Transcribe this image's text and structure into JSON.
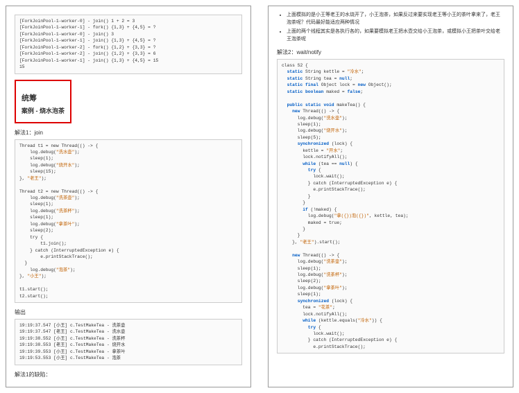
{
  "left": {
    "forkjoin_log": "[ForkJoinPool-1-worker-0] - join() 1 + 2 = 3\n[ForkJoinPool-1-worker-1] - fork() {1,3} + {4,5} = ?\n[ForkJoinPool-1-worker-0] - join() 3\n[ForkJoinPool-1-worker-1] - join() {1,3} + {4,5} = ?\n[ForkJoinPool-1-worker-2] - fork() {1,2} + {3,3} = ?\n[ForkJoinPool-1-worker-2] - join() {1,2} + {3,3} = 6\n[ForkJoinPool-1-worker-1] - join() {1,3} + {4,5} = 15\n15",
    "chapter": "统筹",
    "case_title": "案例 - 烧水泡茶",
    "sol1_title": "解法1：join",
    "sol1_code": [
      "Thread t1 = new Thread(() -> {",
      "  log.debug(",
      "  sleep(1);",
      "  log.debug(",
      "  sleep(15);",
      "}, ",
      "",
      "Thread t2 = new Thread(() -> {",
      "  log.debug(",
      "  sleep(1);",
      "  log.debug(",
      "  sleep(1);",
      "  log.debug(",
      "  sleep(2);",
      "  try {",
      "    t1.join();",
      "  } catch (InterruptedException e) {",
      "    e.printStackTrace();",
      "  }",
      "  log.debug(",
      "}, ",
      "",
      "t1.start();",
      "t2.start();"
    ],
    "sol1_strings": {
      "s1": "\"洗水壶\"",
      "s2": "\"烧开水\"",
      "s3": "\"老王\"",
      "s4": "\"洗茶壶\"",
      "s5": "\"洗茶杯\"",
      "s6": "\"拿茶叶\"",
      "s7": "\"泡茶\"",
      "s8": "\"小王\""
    },
    "output_title": "输出",
    "output_log": "19:19:37.547 [小王] c.TestMakeTea - 洗茶壶\n19:19:37.547 [老王] c.TestMakeTea - 洗水壶\n19:19:38.552 [小王] c.TestMakeTea - 洗茶杯\n19:19:38.553 [老王] c.TestMakeTea - 烧开水\n19:19:39.553 [小王] c.TestMakeTea - 拿茶叶\n19:19:53.553 [小王] c.TestMakeTea - 泡茶",
    "sol1_footer": "解法1的缺陷："
  },
  "right": {
    "notes": [
      "上面模拟的是小王等老王的水烧开了，小王泡茶，如果反过来要实现老王等小王的茶叶拿来了，老王泡茶呢？代码最好能适应两种情况",
      "上面的两个线程其实是各执行各的，如果要模拟老王把水壶交给小王泡茶，或模拟小王把茶叶交给老王泡茶呢"
    ],
    "sol2_title": "解法2：wait/notify",
    "sol2_code": {
      "class_decl": "class S2 {",
      "f1": "static String kettle = ",
      "f1v": "\"冷水\"",
      "f2": "static String tea = null;",
      "f3": "static final Object lock = new Object();",
      "f4": "static boolean maked = false;",
      "m_sig": "public static void makeTea() {",
      "t1_new": "new Thread(() -> {",
      "t1_l1": "log.debug(",
      "t1_l1v": "\"洗水壶\"",
      "t1_s1": "sleep(1);",
      "t1_l2": "log.debug(",
      "t1_l2v": "\"烧开水\"",
      "t1_s2": "sleep(5);",
      "sync": "synchronized (lock) {",
      "k_set": "kettle = ",
      "k_setv": "\"开水\"",
      "notify": "lock.notifyAll();",
      "while1": "while (tea == null) {",
      "try": "try {",
      "wait": "lock.wait();",
      "catch": "} catch (InterruptedException e) {",
      "ptrace": "e.printStackTrace();",
      "if_maked": "if (!maked) {",
      "log_make": "log.debug(",
      "log_makev": "\"拿({})泡({})\"",
      "make_t": "maked = true;",
      "t1_end": "}, ",
      "t1_name": "\"老王\"",
      "start": ").start();",
      "t2_new": "new Thread(() -> {",
      "t2_l1": "log.debug(",
      "t2_l1v": "\"洗茶壶\"",
      "t2_s1": "sleep(1);",
      "t2_l2": "log.debug(",
      "t2_l2v": "\"洗茶杯\"",
      "t2_s2": "sleep(2);",
      "t2_l3": "log.debug(",
      "t2_l3v": "\"拿茶叶\"",
      "t2_s3": "sleep(1);",
      "tea_set": "tea = ",
      "tea_setv": "\"花茶\"",
      "while2": "while (kettle.equals(",
      "while2v": "\"冷水\"",
      "while2e": ")) {"
    }
  }
}
